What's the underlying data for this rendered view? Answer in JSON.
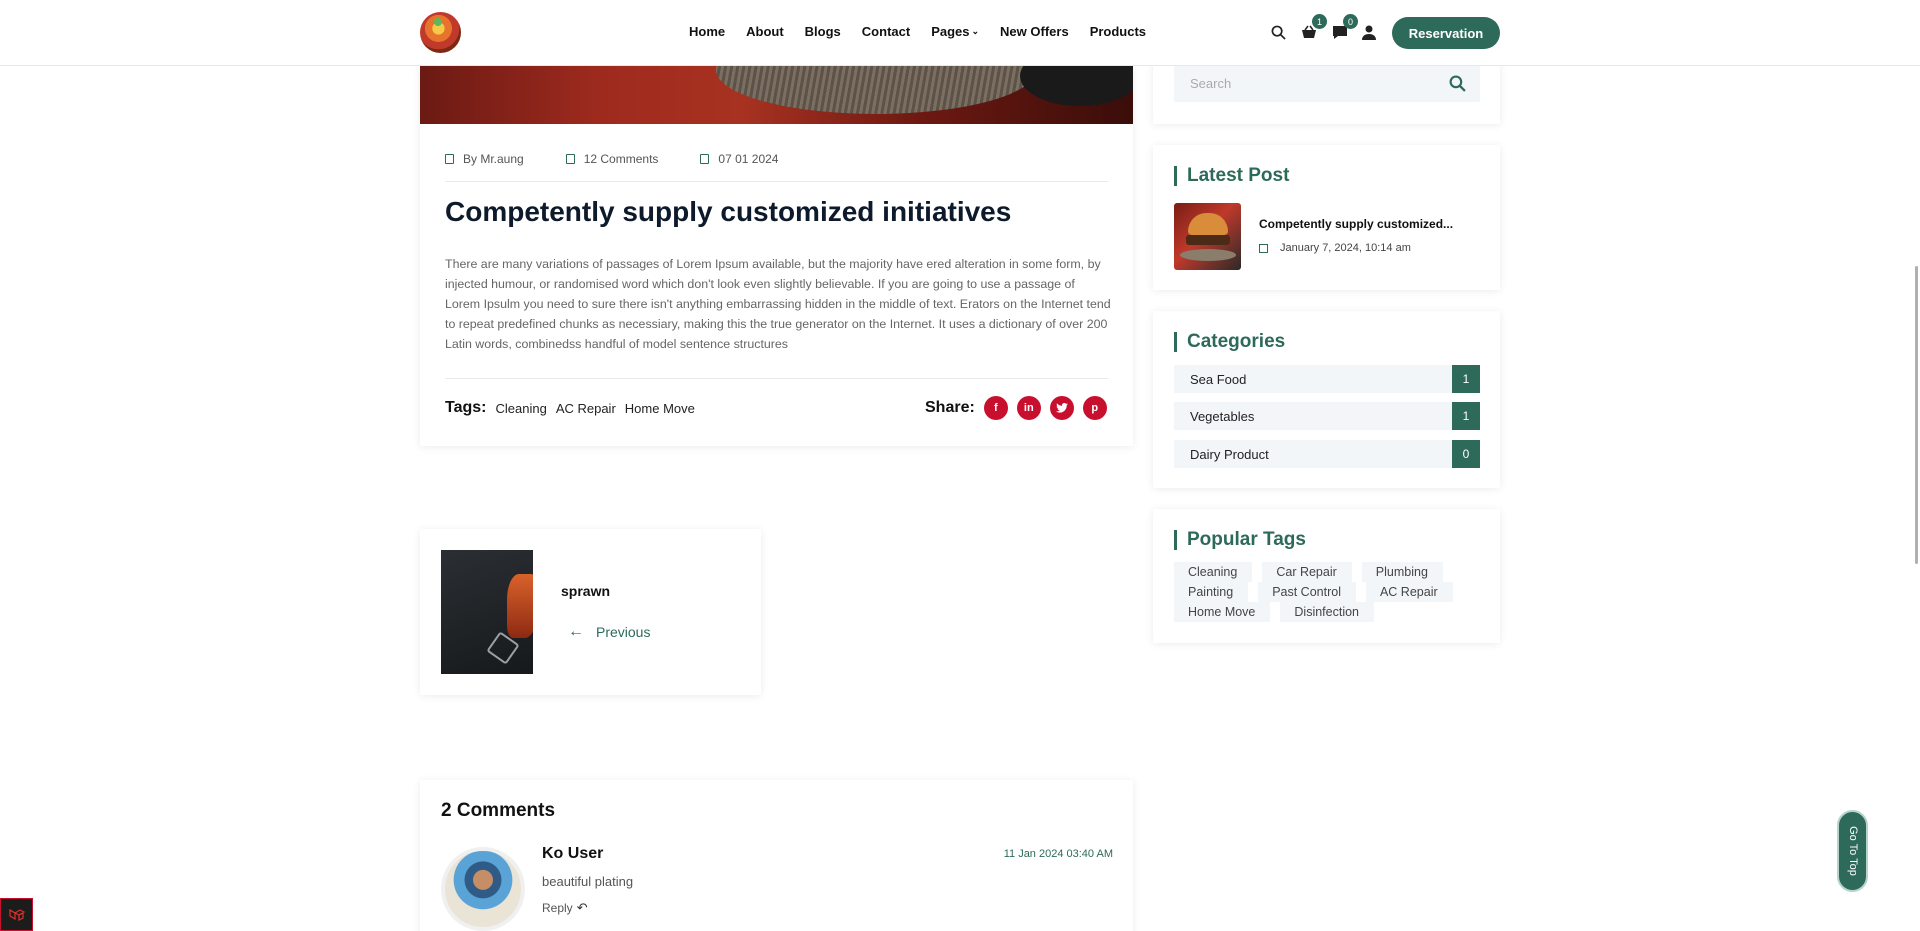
{
  "nav": {
    "items": [
      "Home",
      "About",
      "Blogs",
      "Contact",
      "Pages",
      "New Offers",
      "Products"
    ],
    "cart_count": "1",
    "message_count": "0",
    "reservation_label": "Reservation"
  },
  "article": {
    "author": "By Mr.aung",
    "comments": "12 Comments",
    "date": "07 01 2024",
    "title": "Competently supply customized initiatives",
    "body": "There are many variations of passages of Lorem Ipsum available, but the majority have ered alteration in some form, by injected humour, or randomised word which don't look even slightly believable. If you are going to use a passage of Lorem Ipsulm you need to sure there isn't anything embarrassing hidden in the middle of text. Erators on the Internet tend to repeat predefined chunks as necessiary, making this the true generator on the Internet. It uses a dictionary of over 200 Latin words, combinedss handful of model sentence structures",
    "tags_label": "Tags:",
    "tags": [
      "Cleaning",
      "AC Repair",
      "Home Move"
    ],
    "share_label": "Share:",
    "share_icons": [
      "facebook-icon",
      "linkedin-icon",
      "twitter-icon",
      "pinterest-icon"
    ]
  },
  "prev_post": {
    "name": "sprawn",
    "link": "Previous"
  },
  "comments": {
    "title": "2 Comments",
    "items": [
      {
        "name": "Ko User",
        "text": "beautiful plating",
        "reply": "Reply",
        "date": "11 Jan 2024 03:40 AM"
      }
    ]
  },
  "sidebar": {
    "search_placeholder": "Search",
    "latest_title": "Latest Post",
    "latest_post": {
      "title": "Competently supply customized...",
      "date": "January 7, 2024, 10:14 am"
    },
    "categories_title": "Categories",
    "categories": [
      {
        "name": "Sea Food",
        "count": "1"
      },
      {
        "name": "Vegetables",
        "count": "1"
      },
      {
        "name": "Dairy Product",
        "count": "0"
      }
    ],
    "popular_tags_title": "Popular Tags",
    "popular_tags": [
      "Cleaning",
      "Car Repair",
      "Plumbing",
      "Painting",
      "Past Control",
      "AC Repair",
      "Home Move",
      "Disinfection"
    ]
  },
  "go_top_label": "Go To Top",
  "colors": {
    "accent": "#2d6a5a",
    "share": "#c8102e",
    "muted_bg": "#f3f6f9"
  }
}
